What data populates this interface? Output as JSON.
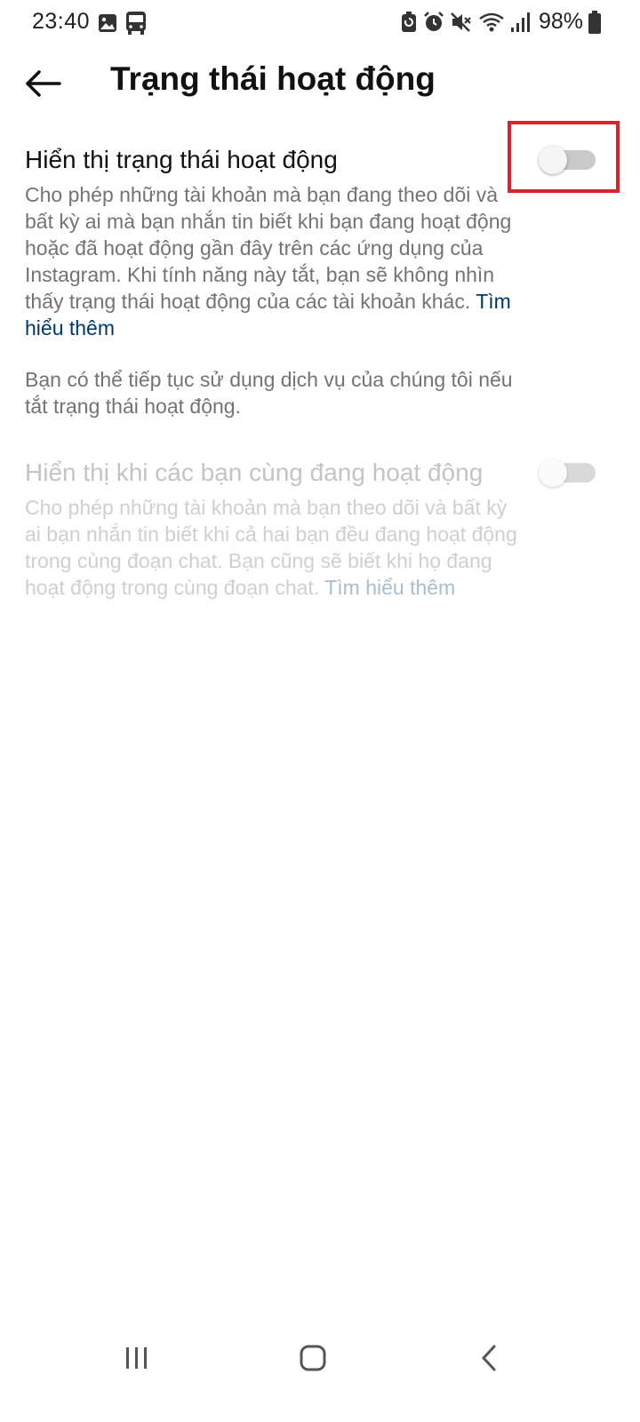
{
  "status_bar": {
    "time": "23:40",
    "battery": "98%",
    "icons_left": [
      "image-icon",
      "bus-icon"
    ],
    "icons_right": [
      "battery-saver-icon",
      "alarm-icon",
      "mute-icon",
      "wifi-icon",
      "signal-icon",
      "battery-icon"
    ]
  },
  "header": {
    "title": "Trạng thái hoạt động"
  },
  "settings": [
    {
      "title": "Hiển thị trạng thái hoạt động",
      "description": "Cho phép những tài khoản mà bạn đang theo dõi và bất kỳ ai mà bạn nhắn tin biết khi bạn đang hoạt động hoặc đã hoạt động gần đây trên các ứng dụng của Instagram. Khi tính năng này tắt, bạn sẽ không nhìn thấy trạng thái hoạt động của các tài khoản khác.",
      "learn_more": "Tìm hiểu thêm",
      "enabled": false
    },
    {
      "title": "Hiển thị khi các bạn cùng đang hoạt động",
      "description": "Cho phép những tài khoản mà bạn theo dõi và bất kỳ ai bạn nhắn tin biết khi cả hai bạn đều đang hoạt động trong cùng đoạn chat. Bạn cũng sẽ biết khi họ đang hoạt động trong cùng đoạn chat.",
      "learn_more": "Tìm hiểu thêm",
      "enabled": false
    }
  ],
  "note": "Bạn có thể tiếp tục sử dụng dịch vụ của chúng tôi nếu tắt trạng thái hoạt động.",
  "colors": {
    "highlight": "#e0202a",
    "link": "#00376b",
    "secondary_text": "#737373"
  },
  "nav_bar": {
    "buttons": [
      "recent-apps-icon",
      "home-icon",
      "back-icon"
    ]
  }
}
